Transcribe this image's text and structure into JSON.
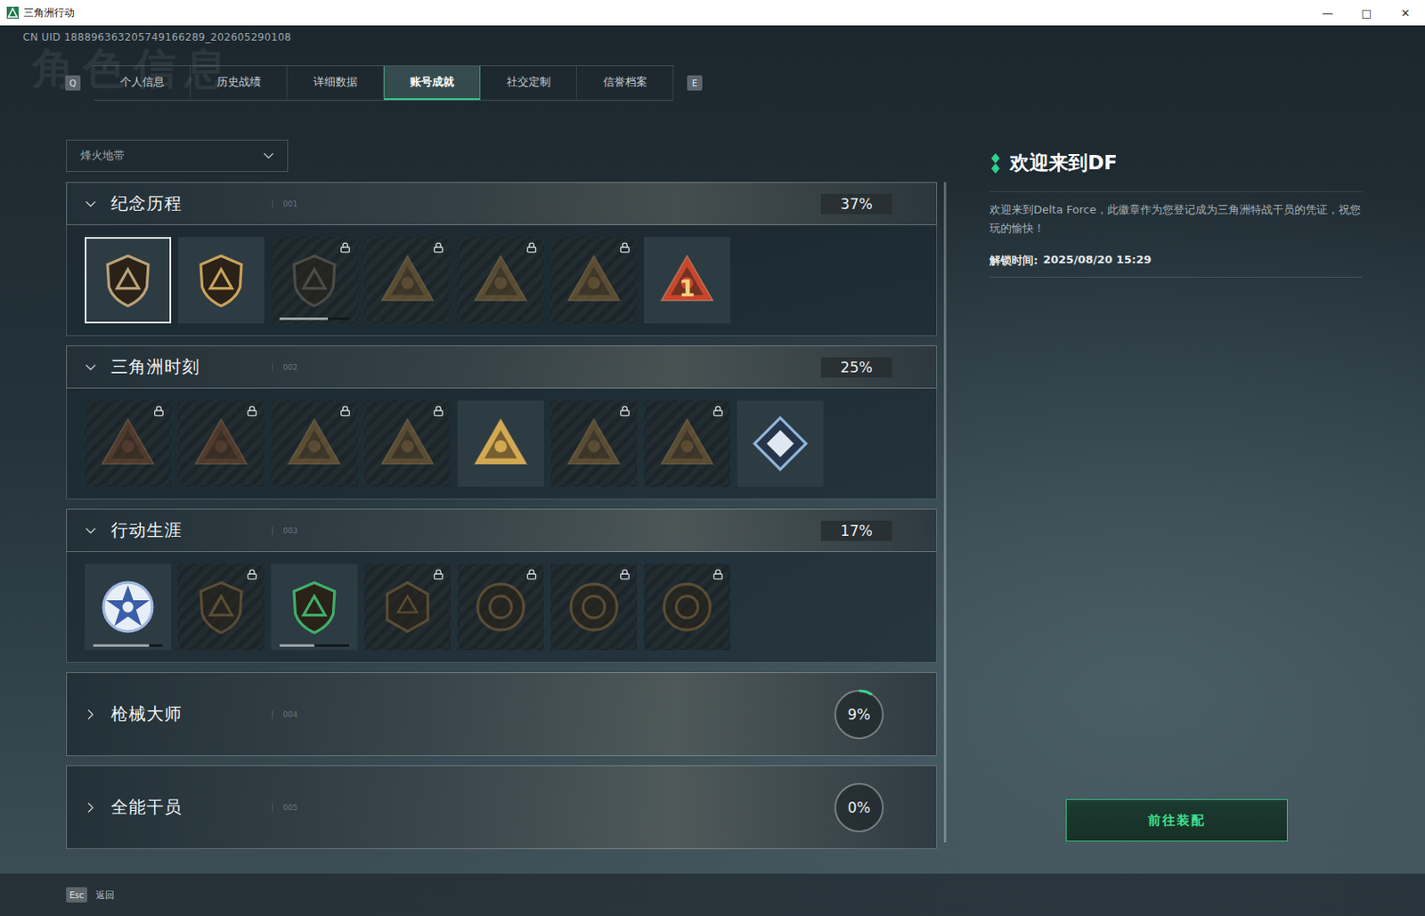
{
  "window": {
    "title": "三角洲行动",
    "controls": [
      "—",
      "□",
      "✕"
    ]
  },
  "uid": "CN UID 188896363205749166289_202605290108",
  "watermark": "角色信息",
  "tabs": {
    "prev_key": "Q",
    "next_key": "E",
    "items": [
      {
        "label": "个人信息",
        "selected": false
      },
      {
        "label": "历史战绩",
        "selected": false
      },
      {
        "label": "详细数据",
        "selected": false
      },
      {
        "label": "账号成就",
        "selected": true
      },
      {
        "label": "社交定制",
        "selected": false
      },
      {
        "label": "信誉档案",
        "selected": false
      }
    ]
  },
  "mode_select": {
    "value": "烽火地带"
  },
  "sections": [
    {
      "title": "纪念历程",
      "code": "001",
      "percent": "37%",
      "expanded": true,
      "badges": [
        {
          "kind": "shield",
          "color": "#b9a27a",
          "locked": false,
          "selected": true
        },
        {
          "kind": "shield",
          "color": "#c9a25a",
          "locked": false,
          "selected": false
        },
        {
          "kind": "shield",
          "color": "#6e6a60",
          "locked": true,
          "selected": false,
          "level": 0.7
        },
        {
          "kind": "triangle",
          "color": "#8a6a3a",
          "locked": true,
          "selected": false
        },
        {
          "kind": "triangle",
          "color": "#8a6a3a",
          "locked": true,
          "selected": false
        },
        {
          "kind": "triangle",
          "color": "#8a6a3a",
          "locked": true,
          "selected": false
        },
        {
          "kind": "triangle",
          "color": "#c8452e",
          "locked": false,
          "selected": false,
          "mark": "1"
        }
      ]
    },
    {
      "title": "三角洲时刻",
      "code": "002",
      "percent": "25%",
      "expanded": true,
      "badges": [
        {
          "kind": "triangle",
          "color": "#7a4a30",
          "locked": true,
          "selected": false
        },
        {
          "kind": "triangle",
          "color": "#7a4a30",
          "locked": true,
          "selected": false
        },
        {
          "kind": "triangle",
          "color": "#8a6a3a",
          "locked": true,
          "selected": false
        },
        {
          "kind": "triangle",
          "color": "#8a6a3a",
          "locked": true,
          "selected": false
        },
        {
          "kind": "triangle",
          "color": "#d4a850",
          "locked": false,
          "selected": false
        },
        {
          "kind": "triangle",
          "color": "#8a6a3a",
          "locked": true,
          "selected": false
        },
        {
          "kind": "triangle",
          "color": "#8a6a3a",
          "locked": true,
          "selected": false
        },
        {
          "kind": "diamond",
          "color": "#8fb4d8",
          "locked": false,
          "selected": false
        }
      ]
    },
    {
      "title": "行动生涯",
      "code": "003",
      "percent": "17%",
      "expanded": true,
      "badges": [
        {
          "kind": "star",
          "color": "#9fb8e0",
          "locked": false,
          "selected": false,
          "level": 0.8
        },
        {
          "kind": "shield",
          "color": "#8a6a3a",
          "locked": true,
          "selected": false
        },
        {
          "kind": "shield",
          "color": "#3fae6a",
          "locked": false,
          "selected": false,
          "level": 0.5
        },
        {
          "kind": "hex",
          "color": "#8a6a3a",
          "locked": true,
          "selected": false
        },
        {
          "kind": "circle",
          "color": "#8a6a3a",
          "locked": true,
          "selected": false
        },
        {
          "kind": "circle",
          "color": "#8a6a3a",
          "locked": true,
          "selected": false
        },
        {
          "kind": "circle",
          "color": "#8a6a3a",
          "locked": true,
          "selected": false
        }
      ]
    },
    {
      "title": "枪械大师",
      "code": "004",
      "percent": "9%",
      "expanded": false,
      "level": 0.09,
      "badges": []
    },
    {
      "title": "全能干员",
      "code": "005",
      "percent": "0%",
      "expanded": false,
      "level": 0,
      "badges": []
    }
  ],
  "detail": {
    "title": "欢迎来到DF",
    "description": "欢迎来到Delta Force，此徽章作为您登记成为三角洲特战干员的凭证，祝您玩的愉快！",
    "unlock_label": "解锁时间:",
    "unlock_time": "2025/08/20 15:29",
    "button": "前往装配"
  },
  "footer": {
    "key": "Esc",
    "label": "返回"
  }
}
